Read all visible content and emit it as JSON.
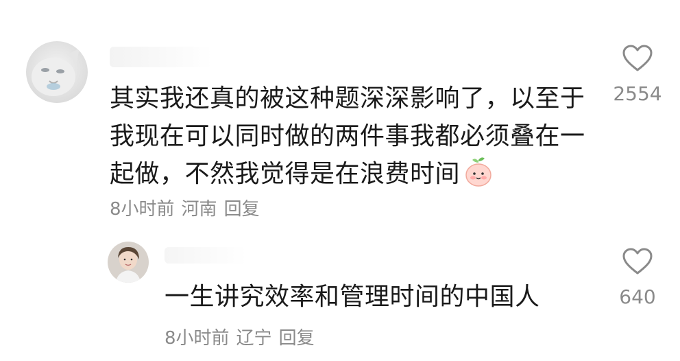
{
  "comment": {
    "text": "其实我还真的被这种题深深影响了，以至于我现在可以同时做的两件事我都必须叠在一起做，不然我觉得是在浪费时间",
    "time": "8小时前",
    "location": "河南",
    "reply_label": "回复",
    "like_count": "2554",
    "emoji": "peach-face-emoji"
  },
  "reply": {
    "text": "一生讲究效率和管理时间的中国人",
    "time": "8小时前",
    "location": "辽宁",
    "reply_label": "回复",
    "like_count": "640"
  },
  "colors": {
    "text": "#1a1a1a",
    "meta": "#8a8a8a",
    "background": "#ffffff"
  }
}
